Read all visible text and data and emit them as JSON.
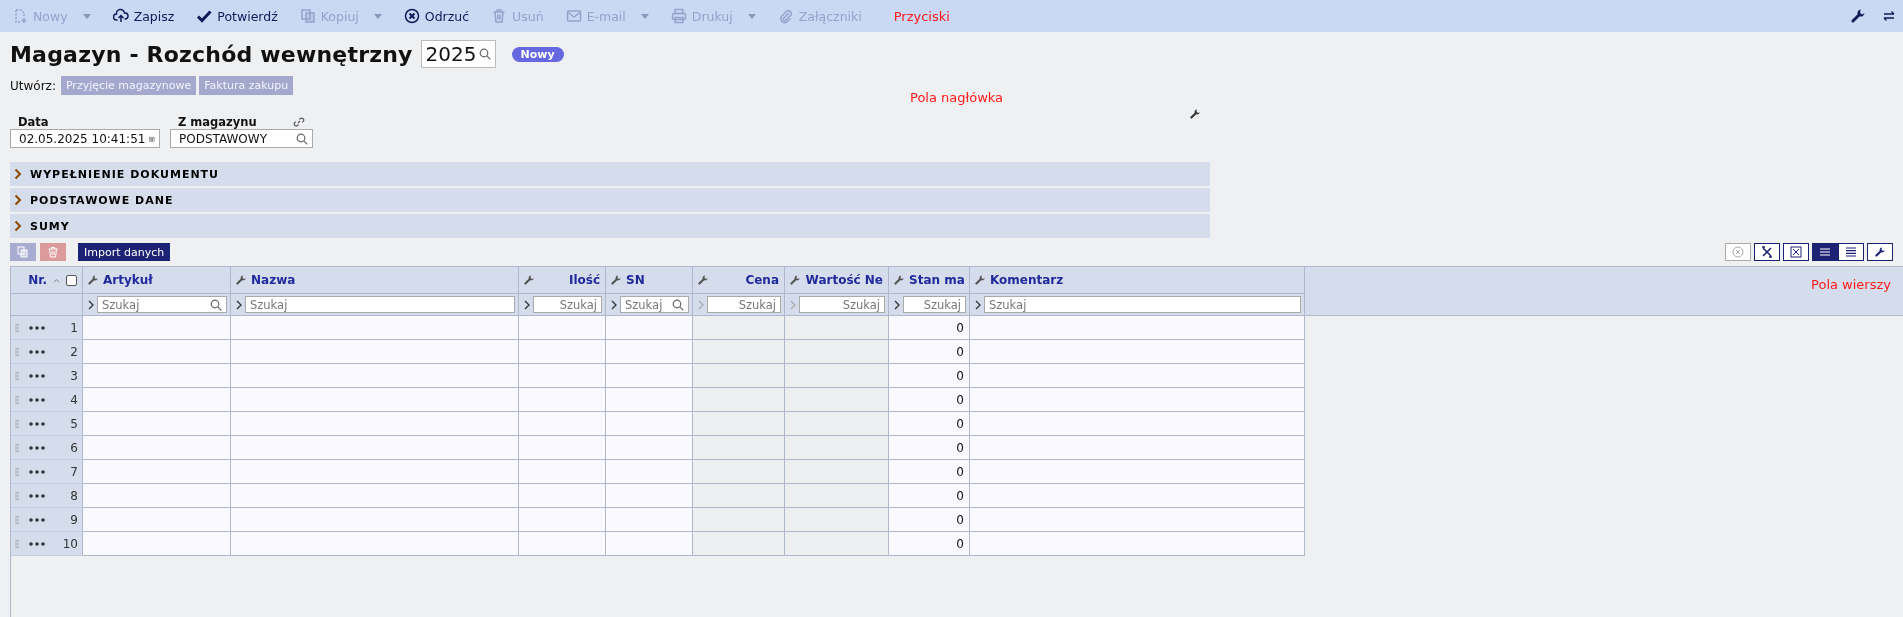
{
  "toolbar": {
    "buttons": [
      {
        "kind": "new",
        "label": "Nowy",
        "disabled": true,
        "dropdown": true
      },
      {
        "kind": "save",
        "label": "Zapisz",
        "disabled": false,
        "dropdown": false
      },
      {
        "kind": "confirm",
        "label": "Potwierdź",
        "disabled": false,
        "dropdown": false
      },
      {
        "kind": "copy",
        "label": "Kopiuj",
        "disabled": true,
        "dropdown": true
      },
      {
        "kind": "reject",
        "label": "Odrzuć",
        "disabled": false,
        "dropdown": false
      },
      {
        "kind": "delete",
        "label": "Usuń",
        "disabled": true,
        "dropdown": false
      },
      {
        "kind": "email",
        "label": "E-mail",
        "disabled": true,
        "dropdown": true
      },
      {
        "kind": "print",
        "label": "Drukuj",
        "disabled": true,
        "dropdown": true
      },
      {
        "kind": "attach",
        "label": "Załączniki",
        "disabled": true,
        "dropdown": false
      }
    ],
    "annotation": "Przyciski"
  },
  "header": {
    "title": "Magazyn - Rozchód wewnętrzny",
    "number": "2025",
    "status": "Nowy",
    "create_label": "Utwórz:",
    "create_buttons": [
      "Przyjęcie magazynowe",
      "Faktura zakupu"
    ],
    "annotation": "Pola nagłówka",
    "fields": [
      {
        "kind": "date",
        "label": "Data",
        "value": "02.05.2025 10:41:51"
      },
      {
        "kind": "lookup",
        "label": "Z magazynu",
        "value": "PODSTAWOWY"
      }
    ]
  },
  "sections": [
    {
      "title": "WYPEŁNIENIE DOKUMENTU",
      "expanded": false
    },
    {
      "title": "PODSTAWOWE DANE",
      "expanded": false
    },
    {
      "title": "SUMY",
      "expanded": false
    }
  ],
  "grid_toolbar": {
    "import_label": "Import danych",
    "tools": [
      {
        "kind": "clear-filter",
        "disabled": true
      },
      {
        "kind": "excel",
        "disabled": false
      },
      {
        "kind": "expand",
        "disabled": false
      }
    ],
    "views": [
      {
        "kind": "compact",
        "selected": true
      },
      {
        "kind": "wide",
        "selected": false
      }
    ]
  },
  "table": {
    "number_header": "Nr.",
    "select_all": {
      "checked": false
    },
    "annotation": "Pola wierszy",
    "columns": [
      {
        "label": "Artykuł",
        "kind": "lookup",
        "placeholder": "Szukaj"
      },
      {
        "label": "Nazwa",
        "kind": "text",
        "placeholder": "Szukaj"
      },
      {
        "label": "Ilość",
        "kind": "number",
        "placeholder": "Szukaj"
      },
      {
        "label": "SN",
        "kind": "lookup",
        "placeholder": "Szukaj"
      },
      {
        "label": "Cena",
        "kind": "computed",
        "placeholder": "Szukaj"
      },
      {
        "label": "Wartość Ne",
        "kind": "computed",
        "placeholder": "Szukaj"
      },
      {
        "label": "Stan ma",
        "kind": "stock",
        "placeholder": "Szukaj"
      },
      {
        "label": "Komentarz",
        "kind": "text",
        "placeholder": "Szukaj"
      }
    ],
    "rows": [
      {
        "number": "1",
        "stock": "0"
      },
      {
        "number": "2",
        "stock": "0"
      },
      {
        "number": "3",
        "stock": "0"
      },
      {
        "number": "4",
        "stock": "0"
      },
      {
        "number": "5",
        "stock": "0"
      },
      {
        "number": "6",
        "stock": "0"
      },
      {
        "number": "7",
        "stock": "0"
      },
      {
        "number": "8",
        "stock": "0"
      },
      {
        "number": "9",
        "stock": "0"
      },
      {
        "number": "10",
        "stock": "0"
      }
    ]
  }
}
